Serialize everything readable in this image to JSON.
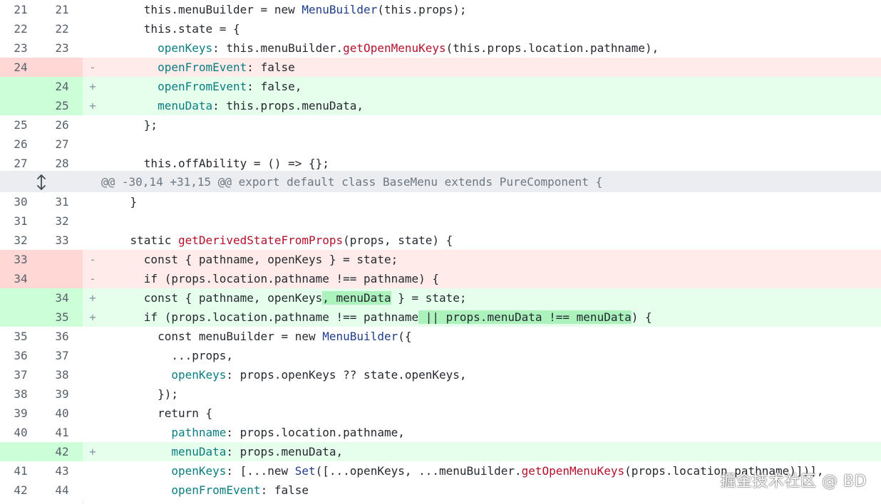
{
  "diff": {
    "hunk_header": "@@ -30,14 +31,15 @@ export default class BaseMenu extends PureComponent {",
    "lines": [
      {
        "old": "21",
        "new": "21",
        "type": "ctx"
      },
      {
        "old": "22",
        "new": "22",
        "type": "ctx"
      },
      {
        "old": "23",
        "new": "23",
        "type": "ctx"
      },
      {
        "old": "24",
        "new": "",
        "type": "del"
      },
      {
        "old": "",
        "new": "24",
        "type": "add"
      },
      {
        "old": "",
        "new": "25",
        "type": "add"
      },
      {
        "old": "25",
        "new": "26",
        "type": "ctx"
      },
      {
        "old": "26",
        "new": "27",
        "type": "ctx"
      },
      {
        "old": "27",
        "new": "28",
        "type": "ctx"
      },
      {
        "old": "30",
        "new": "31",
        "type": "ctx"
      },
      {
        "old": "31",
        "new": "32",
        "type": "ctx"
      },
      {
        "old": "32",
        "new": "33",
        "type": "ctx"
      },
      {
        "old": "33",
        "new": "",
        "type": "del"
      },
      {
        "old": "34",
        "new": "",
        "type": "del"
      },
      {
        "old": "",
        "new": "34",
        "type": "add"
      },
      {
        "old": "",
        "new": "35",
        "type": "add"
      },
      {
        "old": "35",
        "new": "36",
        "type": "ctx"
      },
      {
        "old": "36",
        "new": "37",
        "type": "ctx"
      },
      {
        "old": "37",
        "new": "38",
        "type": "ctx"
      },
      {
        "old": "38",
        "new": "39",
        "type": "ctx"
      },
      {
        "old": "39",
        "new": "40",
        "type": "ctx"
      },
      {
        "old": "40",
        "new": "41",
        "type": "ctx"
      },
      {
        "old": "",
        "new": "42",
        "type": "add"
      },
      {
        "old": "41",
        "new": "43",
        "type": "ctx"
      },
      {
        "old": "42",
        "new": "44",
        "type": "ctx"
      }
    ],
    "markers": {
      "add": "+",
      "del": "-"
    },
    "code": {
      "l21": [
        "this",
        ".menuBuilder = new ",
        "MenuBuilder",
        "(this.props);"
      ],
      "l22": "this.state = {",
      "l23a": "openKeys",
      "l23b": ": this.menuBuilder.",
      "l23c": "getOpenMenuKeys",
      "l23d": "(this.props.location.pathname),",
      "l24del_a": "openFromEvent",
      "l24del_b": ": false",
      "l24add_a": "openFromEvent",
      "l24add_b": ": false,",
      "l25add_a": "menuData",
      "l25add_b": ": this.props.menuData,",
      "l26": "};",
      "l27": "",
      "l28": "this.offAbility = () => {};",
      "l31": "}",
      "l32": "",
      "l33a": "static ",
      "l33b": "getDerivedStateFromProps",
      "l33c": "(props, state) {",
      "d33": "const { pathname, openKeys } = state;",
      "d34": "if (props.location.pathname !== pathname) {",
      "a34a": "const { pathname, openKeys",
      "a34b": ", menuData",
      "a34c": " } = state;",
      "a35a": "if (props.location.pathname !== pathname",
      "a35b": " || props.menuData !== menuData",
      "a35c": ") {",
      "l36a": "const menuBuilder = new ",
      "l36b": "MenuBuilder",
      "l36c": "({",
      "l37": "...props,",
      "l38a": "openKeys",
      "l38b": ": props.openKeys ?? state.openKeys,",
      "l39": "});",
      "l40": "return {",
      "l41a": "pathname",
      "l41b": ": props.location.pathname,",
      "l42a": "menuData",
      "l42b": ": props.menuData,",
      "l43a": "openKeys",
      "l43b": ": [...new ",
      "l43c": "Set",
      "l43d": "([...openKeys, ...menuBuilder.",
      "l43e": "getOpenMenuKeys",
      "l43f": "(props.location.pathname)])],",
      "l44a": "openFromEvent",
      "l44b": ": false"
    }
  },
  "hunk_expand_icon": "expand-vertical-icon",
  "watermark": "掘金技术社区 @ BD",
  "colors": {
    "del_bg": "#ffebe9",
    "add_bg": "#e6ffec",
    "hunk_bg": "#ebedf0",
    "function_red": "#b3112b",
    "property_teal": "#0b7d80",
    "class_blue": "#1f3d8a"
  }
}
